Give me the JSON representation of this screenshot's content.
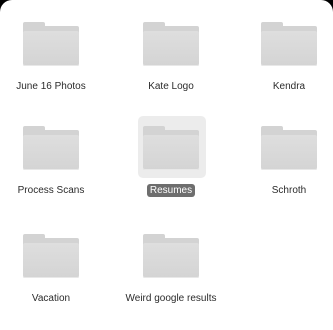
{
  "folders": [
    {
      "name": "June 16 Photos"
    },
    {
      "name": "Kate Logo"
    },
    {
      "name": "Kendra"
    },
    {
      "name": "Process Scans"
    },
    {
      "name": "Resumes",
      "selected": true
    },
    {
      "name": "Schroth"
    },
    {
      "name": "Vacation"
    },
    {
      "name": "Weird google results"
    }
  ],
  "colors": {
    "background": "#ffffff",
    "folder": "#d6d6d6",
    "selection_label_bg": "#6e6e6e",
    "selection_icon_bg": "#ececec"
  },
  "icons": [
    "folder-icon"
  ]
}
